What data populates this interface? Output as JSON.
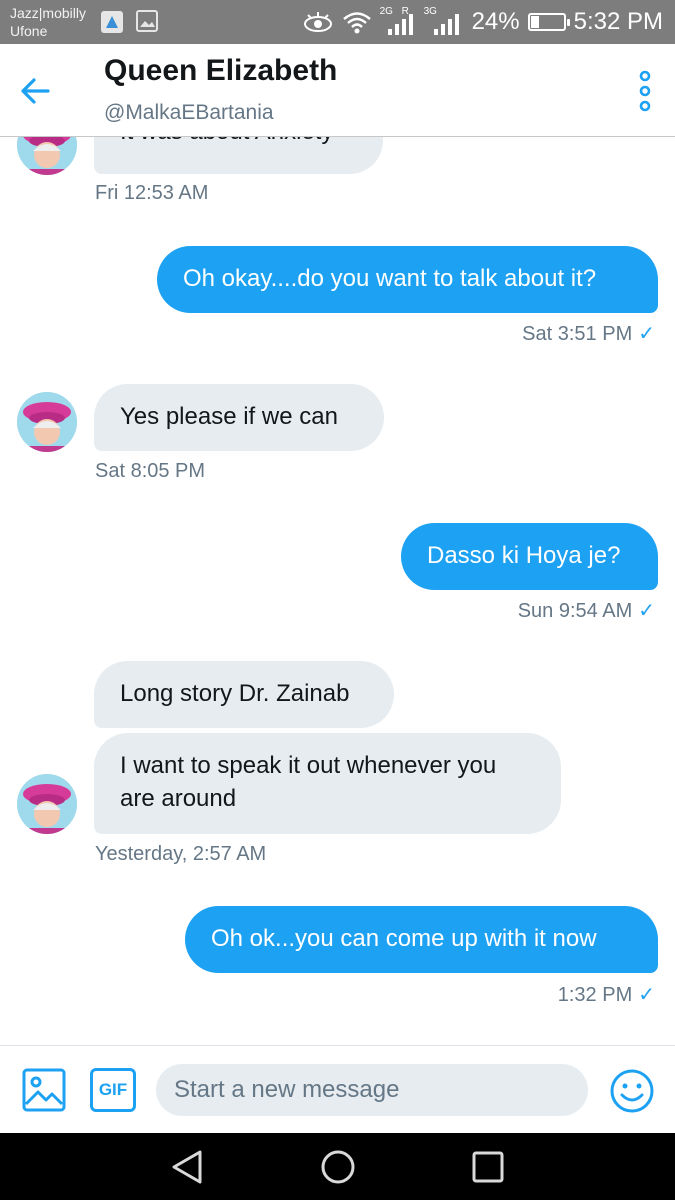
{
  "status_bar": {
    "carrier_line1": "Jazz|mobilly",
    "carrier_line2": "Ufone",
    "network1": "2G",
    "network2": "3G",
    "roaming": "R",
    "battery": "24%",
    "battery_level": 0.24,
    "time": "5:32 PM"
  },
  "header": {
    "name": "Queen Elizabeth",
    "handle": "@MalkaEBartania"
  },
  "messages": [
    {
      "type": "received",
      "text": "It was about Anxiety",
      "time": "Fri 12:53 AM"
    },
    {
      "type": "sent",
      "text": "Oh okay....do you want to talk about it?",
      "time": "Sat 3:51 PM"
    },
    {
      "type": "received",
      "text": "Yes please if we can",
      "time": "Sat 8:05 PM"
    },
    {
      "type": "sent",
      "text": "Dasso ki Hoya je?",
      "time": "Sun 9:54 AM"
    },
    {
      "type": "received",
      "text": "Long story Dr. Zainab"
    },
    {
      "type": "received",
      "text": "I want to speak it out whenever you are around",
      "time": "Yesterday, 2:57 AM"
    },
    {
      "type": "sent",
      "text": "Oh ok...you can come up with it now",
      "time": "1:32 PM"
    }
  ],
  "read_mark": "✓",
  "compose": {
    "gif_label": "GIF",
    "placeholder": "Start a new message"
  },
  "colors": {
    "accent": "#1da1f2",
    "received_bubble": "#e6ecf0",
    "secondary_text": "#657786"
  }
}
